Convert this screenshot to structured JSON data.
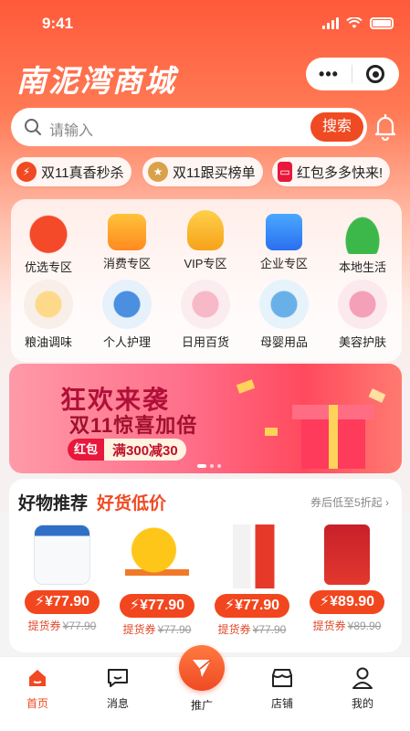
{
  "status_bar": {
    "time": "9:41"
  },
  "header": {
    "brand": "南泥湾商城",
    "capsule_icons": [
      "more-dots-icon",
      "target-circle-icon"
    ]
  },
  "search": {
    "placeholder": "请输入",
    "button": "搜索",
    "bell_icon": "bell-icon"
  },
  "promos": [
    {
      "label": "双11真香秒杀",
      "icon": "lightning-icon"
    },
    {
      "label": "双11跟买榜单",
      "icon": "medal-icon"
    },
    {
      "label": "红包多多快来!",
      "icon": "red-envelope-icon"
    }
  ],
  "categories": [
    {
      "label": "优选专区",
      "icon": "alarm-clock-icon"
    },
    {
      "label": "消费专区",
      "icon": "yuan-wallet-icon"
    },
    {
      "label": "VIP专区",
      "icon": "vip-shield-icon"
    },
    {
      "label": "企业专区",
      "icon": "building-icon"
    },
    {
      "label": "本地生活",
      "icon": "tea-cup-icon"
    },
    {
      "label": "粮油调味",
      "icon": "grain-oil-icon"
    },
    {
      "label": "个人护理",
      "icon": "hand-soap-icon"
    },
    {
      "label": "日用百货",
      "icon": "daily-goods-icon"
    },
    {
      "label": "母婴用品",
      "icon": "baby-formula-icon"
    },
    {
      "label": "美容护肤",
      "icon": "skincare-bottle-icon"
    }
  ],
  "banner": {
    "line1": "狂欢来袭",
    "line2": "双11惊喜加倍",
    "tag_left": "红包",
    "tag_right": "满300减30"
  },
  "recommend": {
    "title": "好物推荐",
    "subtitle": "好货低价",
    "more": "券后低至5折起",
    "products": [
      {
        "price": "¥77.90",
        "coupon_label": "提货券",
        "original": "¥77.90",
        "icon": "cream-jar-icon"
      },
      {
        "price": "¥77.90",
        "coupon_label": "提货券",
        "original": "¥77.90",
        "icon": "rocking-horse-icon"
      },
      {
        "price": "¥77.90",
        "coupon_label": "提货券",
        "original": "¥77.90",
        "icon": "liquor-bottle-icon"
      },
      {
        "price": "¥89.90",
        "coupon_label": "提货券",
        "original": "¥89.90",
        "icon": "rice-bag-icon"
      }
    ]
  },
  "tabbar": [
    {
      "label": "首页",
      "icon": "home-icon",
      "active": true
    },
    {
      "label": "消息",
      "icon": "message-icon",
      "active": false
    },
    {
      "label": "推广",
      "icon": "paper-plane-icon",
      "active": false
    },
    {
      "label": "店铺",
      "icon": "store-icon",
      "active": false
    },
    {
      "label": "我的",
      "icon": "user-icon",
      "active": false
    }
  ],
  "colors": {
    "accent": "#f04a23",
    "hero_top": "#ff5a3a"
  }
}
